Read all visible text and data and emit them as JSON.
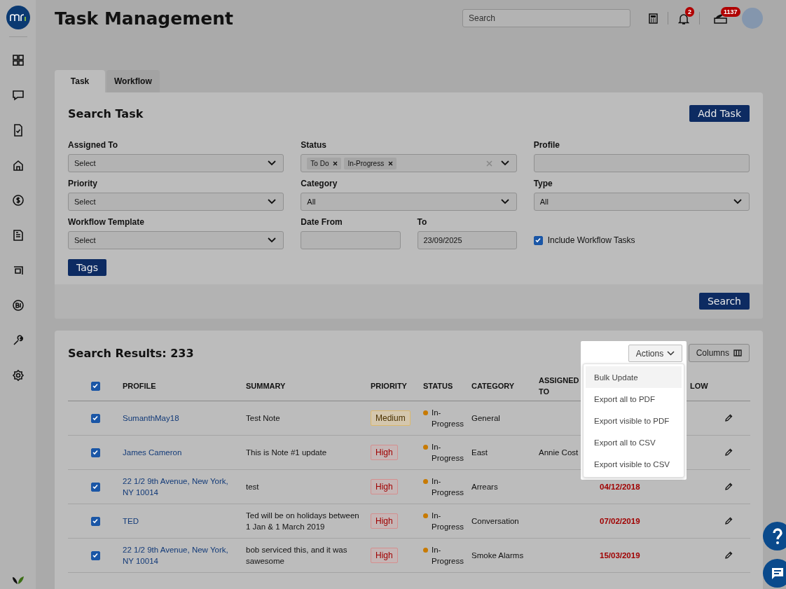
{
  "header": {
    "title": "Task Management",
    "search": {
      "placeholder": "Search"
    },
    "notifications_badge": "2",
    "messages_badge": "1137"
  },
  "tabs": [
    {
      "label": "Task",
      "selected": true
    },
    {
      "label": "Workflow",
      "selected": false
    }
  ],
  "search_panel": {
    "title": "Search Task",
    "add_button": "Add Task",
    "filters": [
      {
        "kind": "select",
        "label": "Assigned To",
        "value": "Select"
      },
      {
        "kind": "multiselect",
        "label": "Status",
        "chips": [
          "To Do",
          "In-Progress"
        ]
      },
      {
        "kind": "text",
        "label": "Profile"
      },
      {
        "kind": "select",
        "label": "Priority",
        "value": "Select"
      },
      {
        "kind": "select",
        "label": "Category",
        "value": "All"
      },
      {
        "kind": "select",
        "label": "Type",
        "value": "All"
      },
      {
        "kind": "select",
        "label": "Workflow Template",
        "value": "Select"
      },
      {
        "kind": "date",
        "label": "Date From"
      },
      {
        "kind": "date",
        "label": "To",
        "value": "23/09/2025"
      },
      {
        "kind": "checkbox",
        "label": "Include Workflow Tasks",
        "checked": true
      }
    ],
    "tags_button": "Tags",
    "search_button": "Search"
  },
  "results": {
    "title": "Search Results: 233",
    "actions_button": "Actions",
    "columns_button": "Columns",
    "actions_menu": [
      {
        "label": "Bulk Update",
        "selected": true
      },
      {
        "label": "Export all to PDF",
        "selected": false
      },
      {
        "label": "Export visible to PDF",
        "selected": false
      },
      {
        "label": "Export all to CSV",
        "selected": false
      },
      {
        "label": "Export visible to CSV",
        "selected": false
      }
    ],
    "select_all": true,
    "columns": [
      "PROFILE",
      "SUMMARY",
      "PRIORITY",
      "STATUS",
      "CATEGORY",
      "ASSIGNED TO",
      "LOW"
    ],
    "rows": [
      {
        "checked": true,
        "profile": "SumanthMay18",
        "summary": "Test Note",
        "priority": {
          "label": "Medium",
          "kind": "medium"
        },
        "status": "In-Progress",
        "category": "General"
      },
      {
        "checked": true,
        "profile": "James Cameron",
        "summary": "This is Note #1 update",
        "priority": {
          "label": "High",
          "kind": "high"
        },
        "status": "In-Progress",
        "category": "East",
        "assigned": "Annie Cost"
      },
      {
        "checked": true,
        "profile": "22 1/2 9th Avenue, New York, NY 10014",
        "summary": "test",
        "priority": {
          "label": "High",
          "kind": "high"
        },
        "status": "In-Progress",
        "category": "Arrears",
        "due": "04/12/2018"
      },
      {
        "checked": true,
        "profile": "TED",
        "summary": "Ted will be on holidays between 1 Jan & 1 March 2019",
        "priority": {
          "label": "High",
          "kind": "high"
        },
        "status": "In-Progress",
        "category": "Conversation",
        "due": "07/02/2019"
      },
      {
        "checked": true,
        "profile": "22 1/2 9th Avenue, New York, NY 10014",
        "summary": "bob serviced this, and it was sawesome",
        "priority": {
          "label": "High",
          "kind": "high"
        },
        "status": "In-Progress",
        "category": "Smoke Alarms",
        "due": "15/03/2019"
      }
    ]
  }
}
